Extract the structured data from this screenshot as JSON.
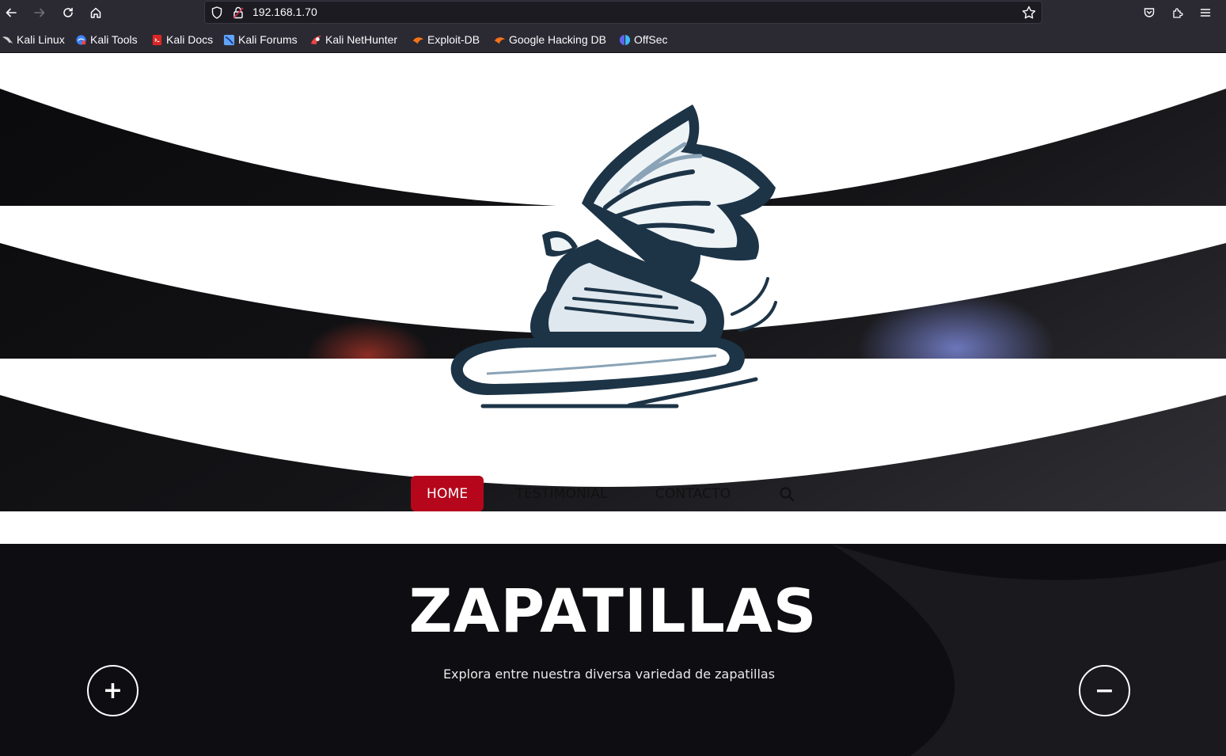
{
  "browser": {
    "url": "192.168.1.70",
    "nav_icons": [
      "back-arrow-icon",
      "forward-arrow-icon",
      "reload-icon",
      "home-icon"
    ],
    "right_icons": [
      "pocket-icon",
      "extensions-icon",
      "menu-icon"
    ]
  },
  "bookmarks": [
    {
      "label": "Kali Linux",
      "icon": "kali-dragon-icon",
      "color": "#d0d0d0"
    },
    {
      "label": "Kali Tools",
      "icon": "kali-tools-icon",
      "color": "#3b82f6"
    },
    {
      "label": "Kali Docs",
      "icon": "kali-docs-icon",
      "color": "#dc2626"
    },
    {
      "label": "Kali Forums",
      "icon": "kali-forums-icon",
      "color": "#60a5fa"
    },
    {
      "label": "Kali NetHunter",
      "icon": "nethunter-icon",
      "color": "#ef4444"
    },
    {
      "label": "Exploit-DB",
      "icon": "exploit-db-icon",
      "color": "#f97316"
    },
    {
      "label": "Google Hacking DB",
      "icon": "ghdb-icon",
      "color": "#f97316"
    },
    {
      "label": "OffSec",
      "icon": "offsec-icon",
      "color": "#6366f1"
    }
  ],
  "nav": {
    "items": [
      {
        "label": "HOME",
        "active": true
      },
      {
        "label": "TESTIMONIAL",
        "active": false
      },
      {
        "label": "CONTACTO",
        "active": false
      }
    ],
    "accent": "#b5061b"
  },
  "hero": {
    "title": "ZAPATILLAS",
    "subtitle": "Explora entre nuestra diversa variedad de zapatillas",
    "prev_glyph": "+",
    "next_glyph": "−"
  },
  "logo": {
    "icon": "winged-sneaker-logo"
  }
}
